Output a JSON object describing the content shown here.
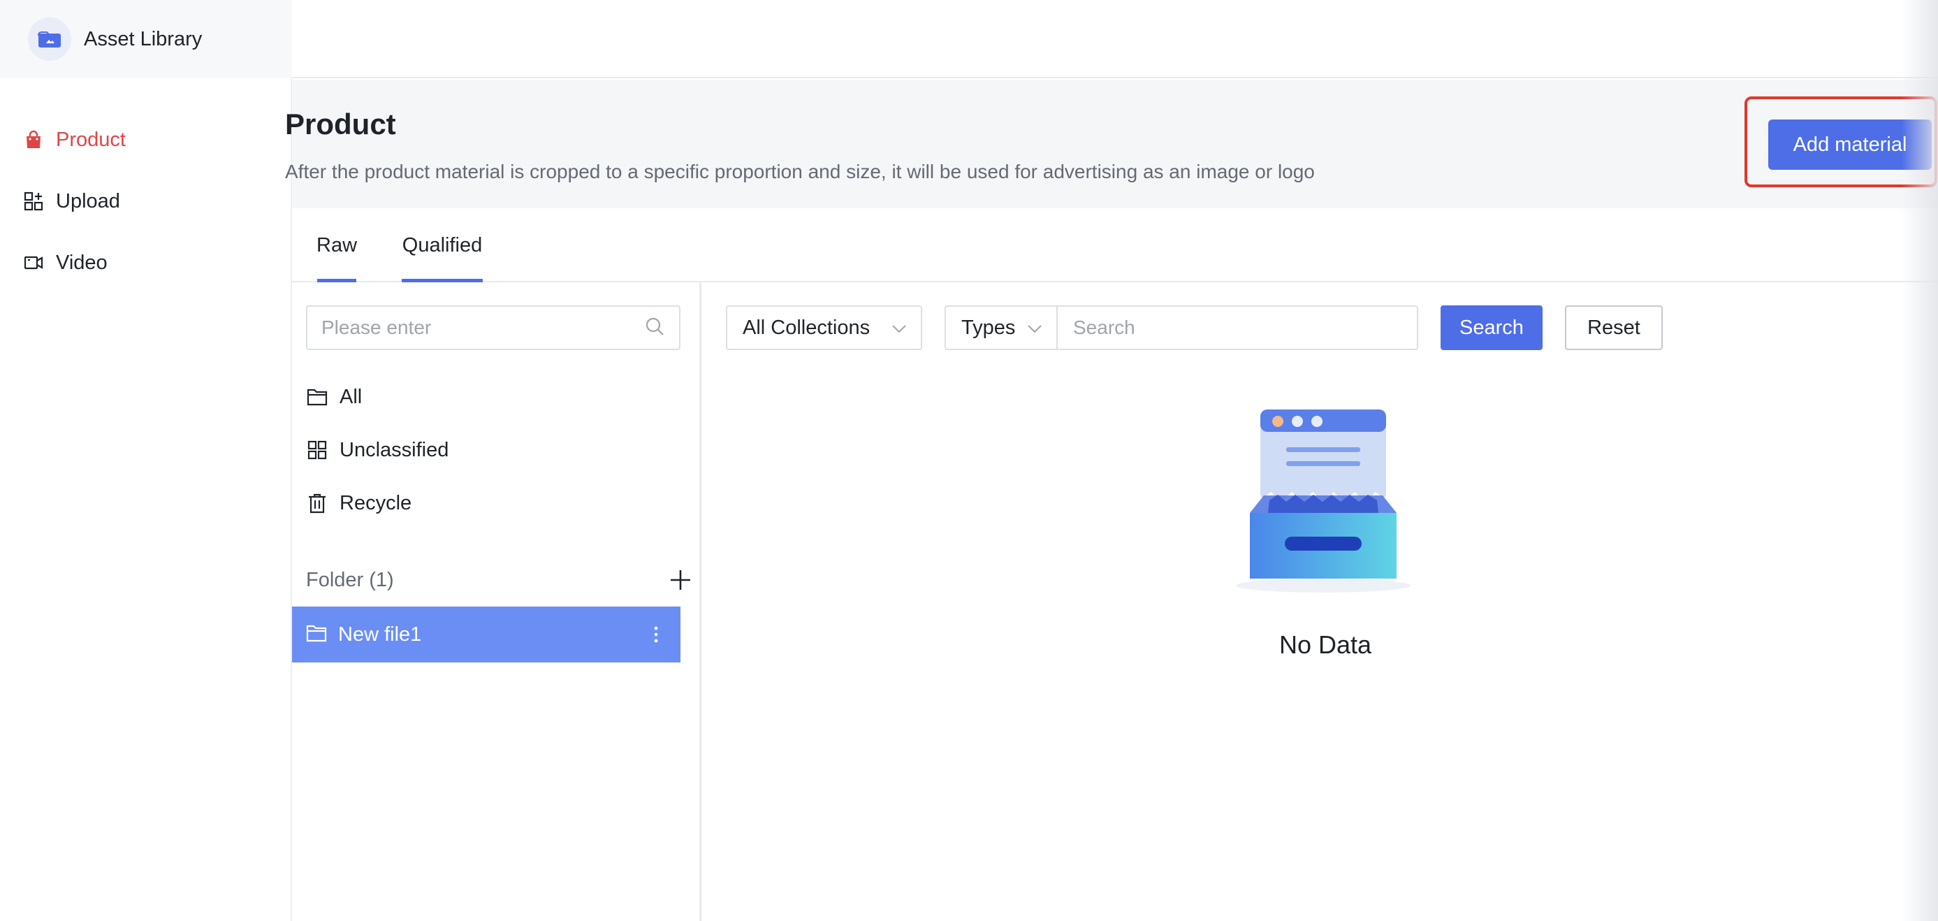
{
  "app": {
    "title": "Asset Library"
  },
  "sidebar": {
    "items": [
      {
        "label": "Product",
        "icon": "shopping-bag-icon",
        "active": true
      },
      {
        "label": "Upload",
        "icon": "upload-grid-icon",
        "active": false
      },
      {
        "label": "Video",
        "icon": "video-icon",
        "active": false
      }
    ]
  },
  "page": {
    "title": "Product",
    "description": "After the product material is cropped to a specific proportion and size, it will be used for advertising as an image or logo",
    "add_button_label": "Add material"
  },
  "tabs": [
    {
      "label": "Raw",
      "selected": true
    },
    {
      "label": "Qualified",
      "selected": false
    }
  ],
  "folders": {
    "search_placeholder": "Please enter",
    "categories": [
      {
        "label": "All",
        "icon": "folder-icon"
      },
      {
        "label": "Unclassified",
        "icon": "grid-icon"
      },
      {
        "label": "Recycle",
        "icon": "trash-icon"
      }
    ],
    "folder_header": "Folder (1)",
    "folder_items": [
      {
        "label": "New file1",
        "selected": true
      }
    ]
  },
  "filters": {
    "collections_value": "All Collections",
    "types_value": "Types",
    "search_placeholder": "Search",
    "search_button_label": "Search",
    "reset_button_label": "Reset"
  },
  "empty_state": {
    "text": "No Data"
  },
  "colors": {
    "primary": "#4e6ee8",
    "active_nav": "#e04545",
    "selected_folder": "#6b8ef5",
    "highlight_outline": "#e0392e"
  }
}
